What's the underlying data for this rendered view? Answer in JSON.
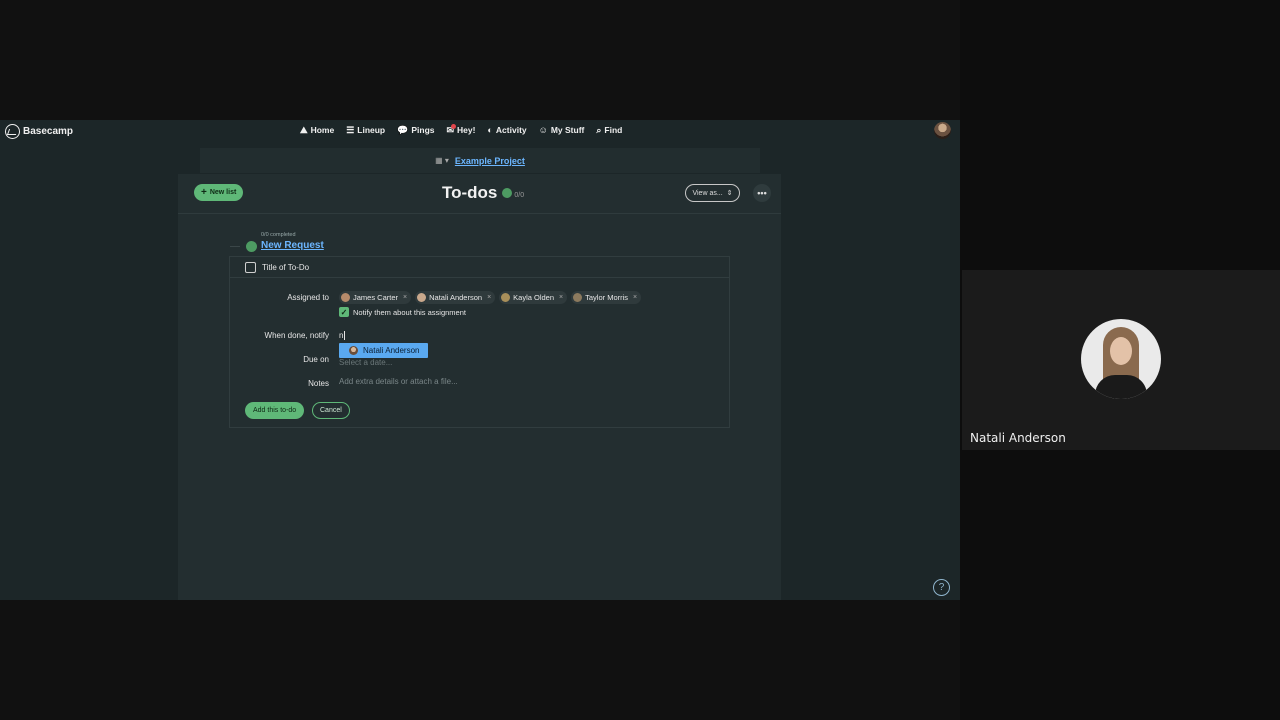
{
  "app": {
    "brand": "Basecamp"
  },
  "nav": {
    "items": [
      {
        "label": "Home",
        "icon": "home-icon",
        "glyph": "⛰"
      },
      {
        "label": "Lineup",
        "icon": "lineup-icon",
        "glyph": "☰"
      },
      {
        "label": "Pings",
        "icon": "pings-icon",
        "glyph": "💬"
      },
      {
        "label": "Hey!",
        "icon": "hey-icon",
        "glyph": "✉"
      },
      {
        "label": "Activity",
        "icon": "activity-icon",
        "glyph": "◐"
      },
      {
        "label": "My Stuff",
        "icon": "my-stuff-icon",
        "glyph": "☺"
      },
      {
        "label": "Find",
        "icon": "find-icon",
        "glyph": "⌕"
      }
    ]
  },
  "project": {
    "name": "Example Project"
  },
  "todos": {
    "new_list_label": "New list",
    "title": "To-dos",
    "count": "0/0",
    "view_as_label": "View as...",
    "more_label": "•••",
    "list": {
      "progress": "0/0 completed",
      "name": "New Request"
    }
  },
  "form": {
    "todo_placeholder": "Title of To-Do",
    "assigned_label": "Assigned to",
    "assignees": [
      {
        "name": "James Carter",
        "color": "#b58a6a"
      },
      {
        "name": "Natali Anderson",
        "color": "#c9a88c"
      },
      {
        "name": "Kayla Olden",
        "color": "#a88f5a"
      },
      {
        "name": "Taylor Morris",
        "color": "#8c7a5e"
      }
    ],
    "notify_assignment_label": "Notify them about this assignment",
    "when_done_label": "When done, notify",
    "when_done_value": "n",
    "suggestion": "Natali Anderson",
    "due_label": "Due on",
    "due_placeholder": "Select a date...",
    "notes_label": "Notes",
    "notes_placeholder": "Add extra details or attach a file...",
    "add_button": "Add this to-do",
    "cancel_button": "Cancel"
  },
  "help_label": "?",
  "participant": {
    "name": "Natali Anderson"
  },
  "colors": {
    "accent_green": "#5fb878",
    "link_blue": "#6cb6ff",
    "background": "#1c2628"
  }
}
